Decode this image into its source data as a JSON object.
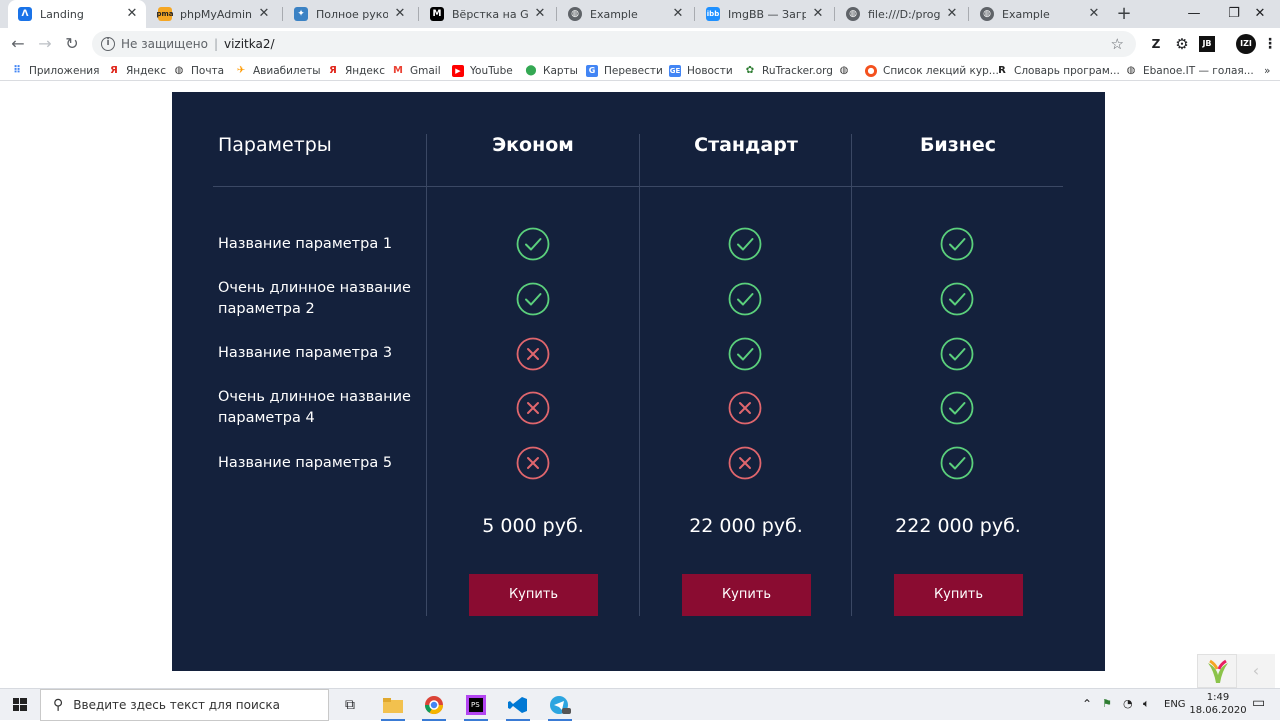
{
  "browser": {
    "tabs": [
      {
        "title": "Landing",
        "favicon_color": "#1a73e8",
        "active": true
      },
      {
        "title": "phpMyAdmin",
        "favicon_color": "#e08a00",
        "active": false
      },
      {
        "title": "Полное руководс",
        "favicon_color": "#f4b400",
        "active": false
      },
      {
        "title": "Вёрстка на Grid в",
        "favicon_color": "#000000",
        "active": false
      },
      {
        "title": "Example",
        "favicon_color": "#5f6368",
        "active": false
      },
      {
        "title": "ImgBB — Загрузит",
        "favicon_color": "#1e90ff",
        "active": false
      },
      {
        "title": "file:///D:/program",
        "favicon_color": "#5f6368",
        "active": false
      },
      {
        "title": "Example",
        "favicon_color": "#5f6368",
        "active": false
      }
    ],
    "omnibox": {
      "security_text": "Не защищено",
      "url": "vizitka2/"
    },
    "extensions": [
      "Z",
      "JB",
      "IZI"
    ],
    "bookmarks": [
      "Приложения",
      "Яндекс",
      "Почта",
      "Авиабилеты",
      "Яндекс",
      "Gmail",
      "YouTube",
      "Карты",
      "Перевести",
      "Новости",
      "RuTracker.org",
      "Список лекций кур...",
      "Словарь програм...",
      "Ebanoe.IT — голая..."
    ]
  },
  "pricing": {
    "params_header": "Параметры",
    "plans": [
      {
        "name": "Эконом",
        "price": "5 000 руб.",
        "buy_label": "Купить"
      },
      {
        "name": "Стандарт",
        "price": "22 000 руб.",
        "buy_label": "Купить"
      },
      {
        "name": "Бизнес",
        "price": "222 000 руб.",
        "buy_label": "Купить"
      }
    ],
    "rows": [
      {
        "label": "Название параметра 1",
        "values": [
          true,
          true,
          true
        ]
      },
      {
        "label": "Очень длинное название параметра 2",
        "values": [
          true,
          true,
          true
        ]
      },
      {
        "label": "Название параметра 3",
        "values": [
          false,
          true,
          true
        ]
      },
      {
        "label": "Очень длинное название параметра 4",
        "values": [
          false,
          false,
          true
        ]
      },
      {
        "label": "Название параметра 5",
        "values": [
          false,
          false,
          true
        ]
      }
    ],
    "colors": {
      "background": "#14213c",
      "check": "#5bd07c",
      "cross": "#e0666d",
      "button": "#8a0c31"
    }
  },
  "taskbar": {
    "search_placeholder": "Введите здесь текст для поиска",
    "language": "ENG",
    "time": "1:49",
    "date": "18.06.2020"
  }
}
